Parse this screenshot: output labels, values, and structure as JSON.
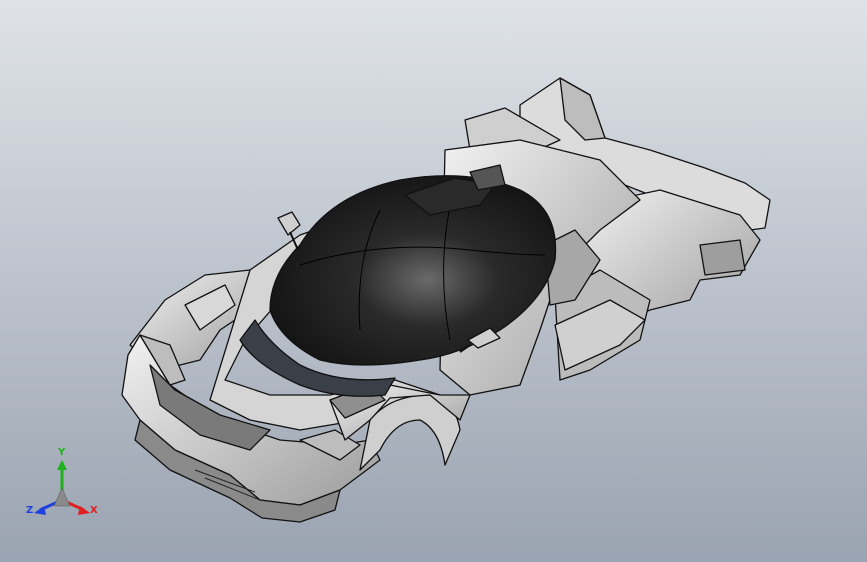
{
  "viewport": {
    "background_top": "#dfe3e8",
    "background_bottom": "#9aa3b1"
  },
  "model": {
    "body_color": "#e6e6e6",
    "panel_shade": "#a9a9a9",
    "canopy_color": "#1a1a1a",
    "edge_color": "#111111"
  },
  "triad": {
    "x_label": "X",
    "y_label": "Y",
    "z_label": "Z",
    "x_color": "#e02020",
    "y_color": "#20b020",
    "z_color": "#2040e0"
  }
}
